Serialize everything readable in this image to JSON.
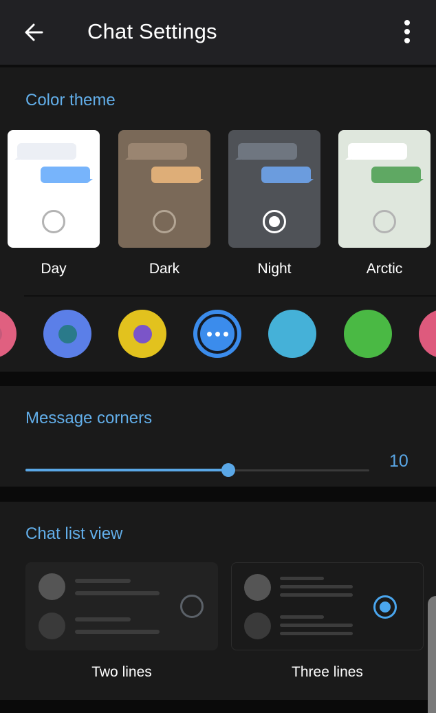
{
  "header": {
    "title": "Chat Settings",
    "back_icon": "arrow-left-icon",
    "menu_icon": "more-vertical-icon"
  },
  "color_theme": {
    "title": "Color theme",
    "themes": [
      {
        "label": "Day",
        "bg": "#ffffff",
        "in_bubble": "#eceff5",
        "out_bubble": "#77b4fb",
        "radio_color": "#b3b3b3",
        "selected": false
      },
      {
        "label": "Dark",
        "bg": "#7a6958",
        "in_bubble": "#9a8571",
        "out_bubble": "#deae78",
        "radio_color": "#b3a594",
        "selected": false
      },
      {
        "label": "Night",
        "bg": "#4f5257",
        "in_bubble": "#6f7680",
        "out_bubble": "#6b9cde",
        "radio_color": "#ffffff",
        "selected": true
      },
      {
        "label": "Arctic",
        "bg": "#dfe7dd",
        "in_bubble": "#ffffff",
        "out_bubble": "#5fa863",
        "radio_color": "#b3b3b3",
        "selected": false
      }
    ],
    "accents": [
      {
        "name": "pink-partial",
        "outer": "#e06080",
        "inner": "#c45a7a",
        "selected": false
      },
      {
        "name": "blue-teal",
        "outer": "#5b7fe8",
        "inner": "#2a7a8a",
        "selected": false
      },
      {
        "name": "yellow-purple",
        "outer": "#e2c21e",
        "inner": "#7b55c8",
        "selected": false
      },
      {
        "name": "blue-custom",
        "outer": "#3b8cec",
        "inner": null,
        "selected": true
      },
      {
        "name": "light-blue",
        "outer": "#45b1d8",
        "inner": null,
        "selected": false
      },
      {
        "name": "green",
        "outer": "#4ab944",
        "inner": null,
        "selected": false
      },
      {
        "name": "pink",
        "outer": "#de5a7d",
        "inner": null,
        "selected": false
      }
    ]
  },
  "message_corners": {
    "title": "Message corners",
    "value": "10",
    "fraction": 0.59
  },
  "chat_list_view": {
    "title": "Chat list view",
    "options": [
      {
        "label": "Two lines",
        "selected": false
      },
      {
        "label": "Three lines",
        "selected": true
      }
    ]
  }
}
